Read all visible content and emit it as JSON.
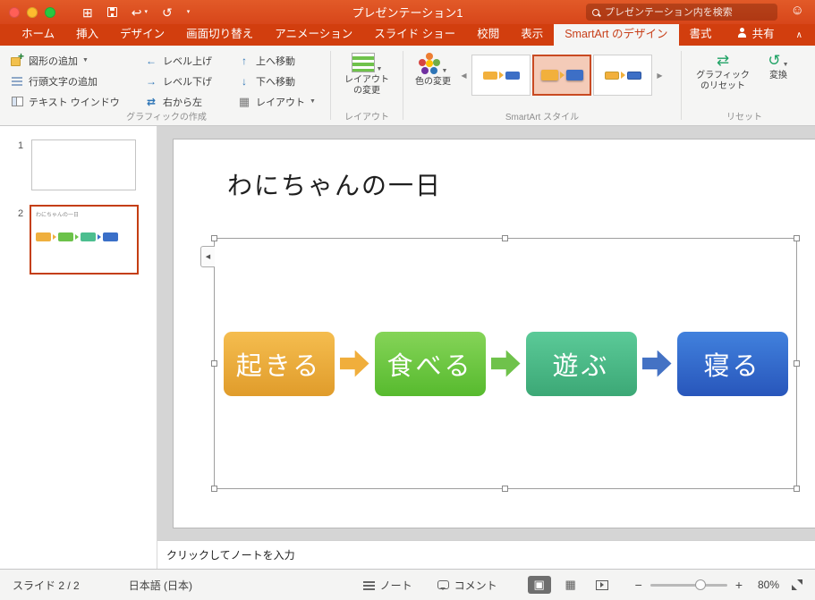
{
  "window": {
    "title": "プレゼンテーション1"
  },
  "titlebar": {
    "search_placeholder": "プレゼンテーション内を検索"
  },
  "tabs": {
    "items": [
      {
        "label": "ホーム"
      },
      {
        "label": "挿入"
      },
      {
        "label": "デザイン"
      },
      {
        "label": "画面切り替え"
      },
      {
        "label": "アニメーション"
      },
      {
        "label": "スライド ショー"
      },
      {
        "label": "校閲"
      },
      {
        "label": "表示"
      },
      {
        "label": "SmartArt のデザイン"
      },
      {
        "label": "書式"
      }
    ],
    "active_tab": "SmartArt のデザイン",
    "share_label": "共有"
  },
  "ribbon": {
    "create_group": {
      "label": "グラフィックの作成",
      "add_shape": "図形の追加",
      "add_bullet": "行頭文字の追加",
      "text_pane": "テキスト ウインドウ",
      "promote": "レベル上げ",
      "demote": "レベル下げ",
      "right_to_left": "右から左",
      "move_up": "上へ移動",
      "move_down": "下へ移動",
      "layout": "レイアウト"
    },
    "layout_group": {
      "label": "レイアウト",
      "change_layout": "レイアウトの変更"
    },
    "styles_group": {
      "label": "SmartArt スタイル",
      "change_colors": "色の変更"
    },
    "reset_group": {
      "label": "リセット",
      "reset_graphic": "グラフィックのリセット",
      "convert": "変換"
    }
  },
  "slides_panel": {
    "slides": [
      {
        "number": "1"
      },
      {
        "number": "2"
      }
    ],
    "selected_slide": "2"
  },
  "slide": {
    "title": "わにちゃんの一日",
    "smartart": {
      "type": "basic-process",
      "shapes": [
        {
          "label": "起きる",
          "fill_top": "#F5BD4F",
          "fill_bottom": "#E09C2B"
        },
        {
          "label": "食べる",
          "fill_top": "#85D458",
          "fill_bottom": "#57BA2E"
        },
        {
          "label": "遊ぶ",
          "fill_top": "#5BCA98",
          "fill_bottom": "#3CA876"
        },
        {
          "label": "寝る",
          "fill_top": "#4181DD",
          "fill_bottom": "#2856BB"
        }
      ],
      "arrow_colors": [
        "#F0AE3C",
        "#6FC24B",
        "#4472C4"
      ]
    }
  },
  "notes": {
    "placeholder": "クリックしてノートを入力"
  },
  "statusbar": {
    "slide_indicator": "スライド 2 / 2",
    "language": "日本語 (日本)",
    "notes_label": "ノート",
    "comments_label": "コメント",
    "zoom_level": "80%"
  },
  "theme": {
    "titlebar_color": "#D9481C",
    "tabbar_color": "#D23E0E",
    "active_tab_text": "#C8401A",
    "selection_color": "#C43E12"
  }
}
